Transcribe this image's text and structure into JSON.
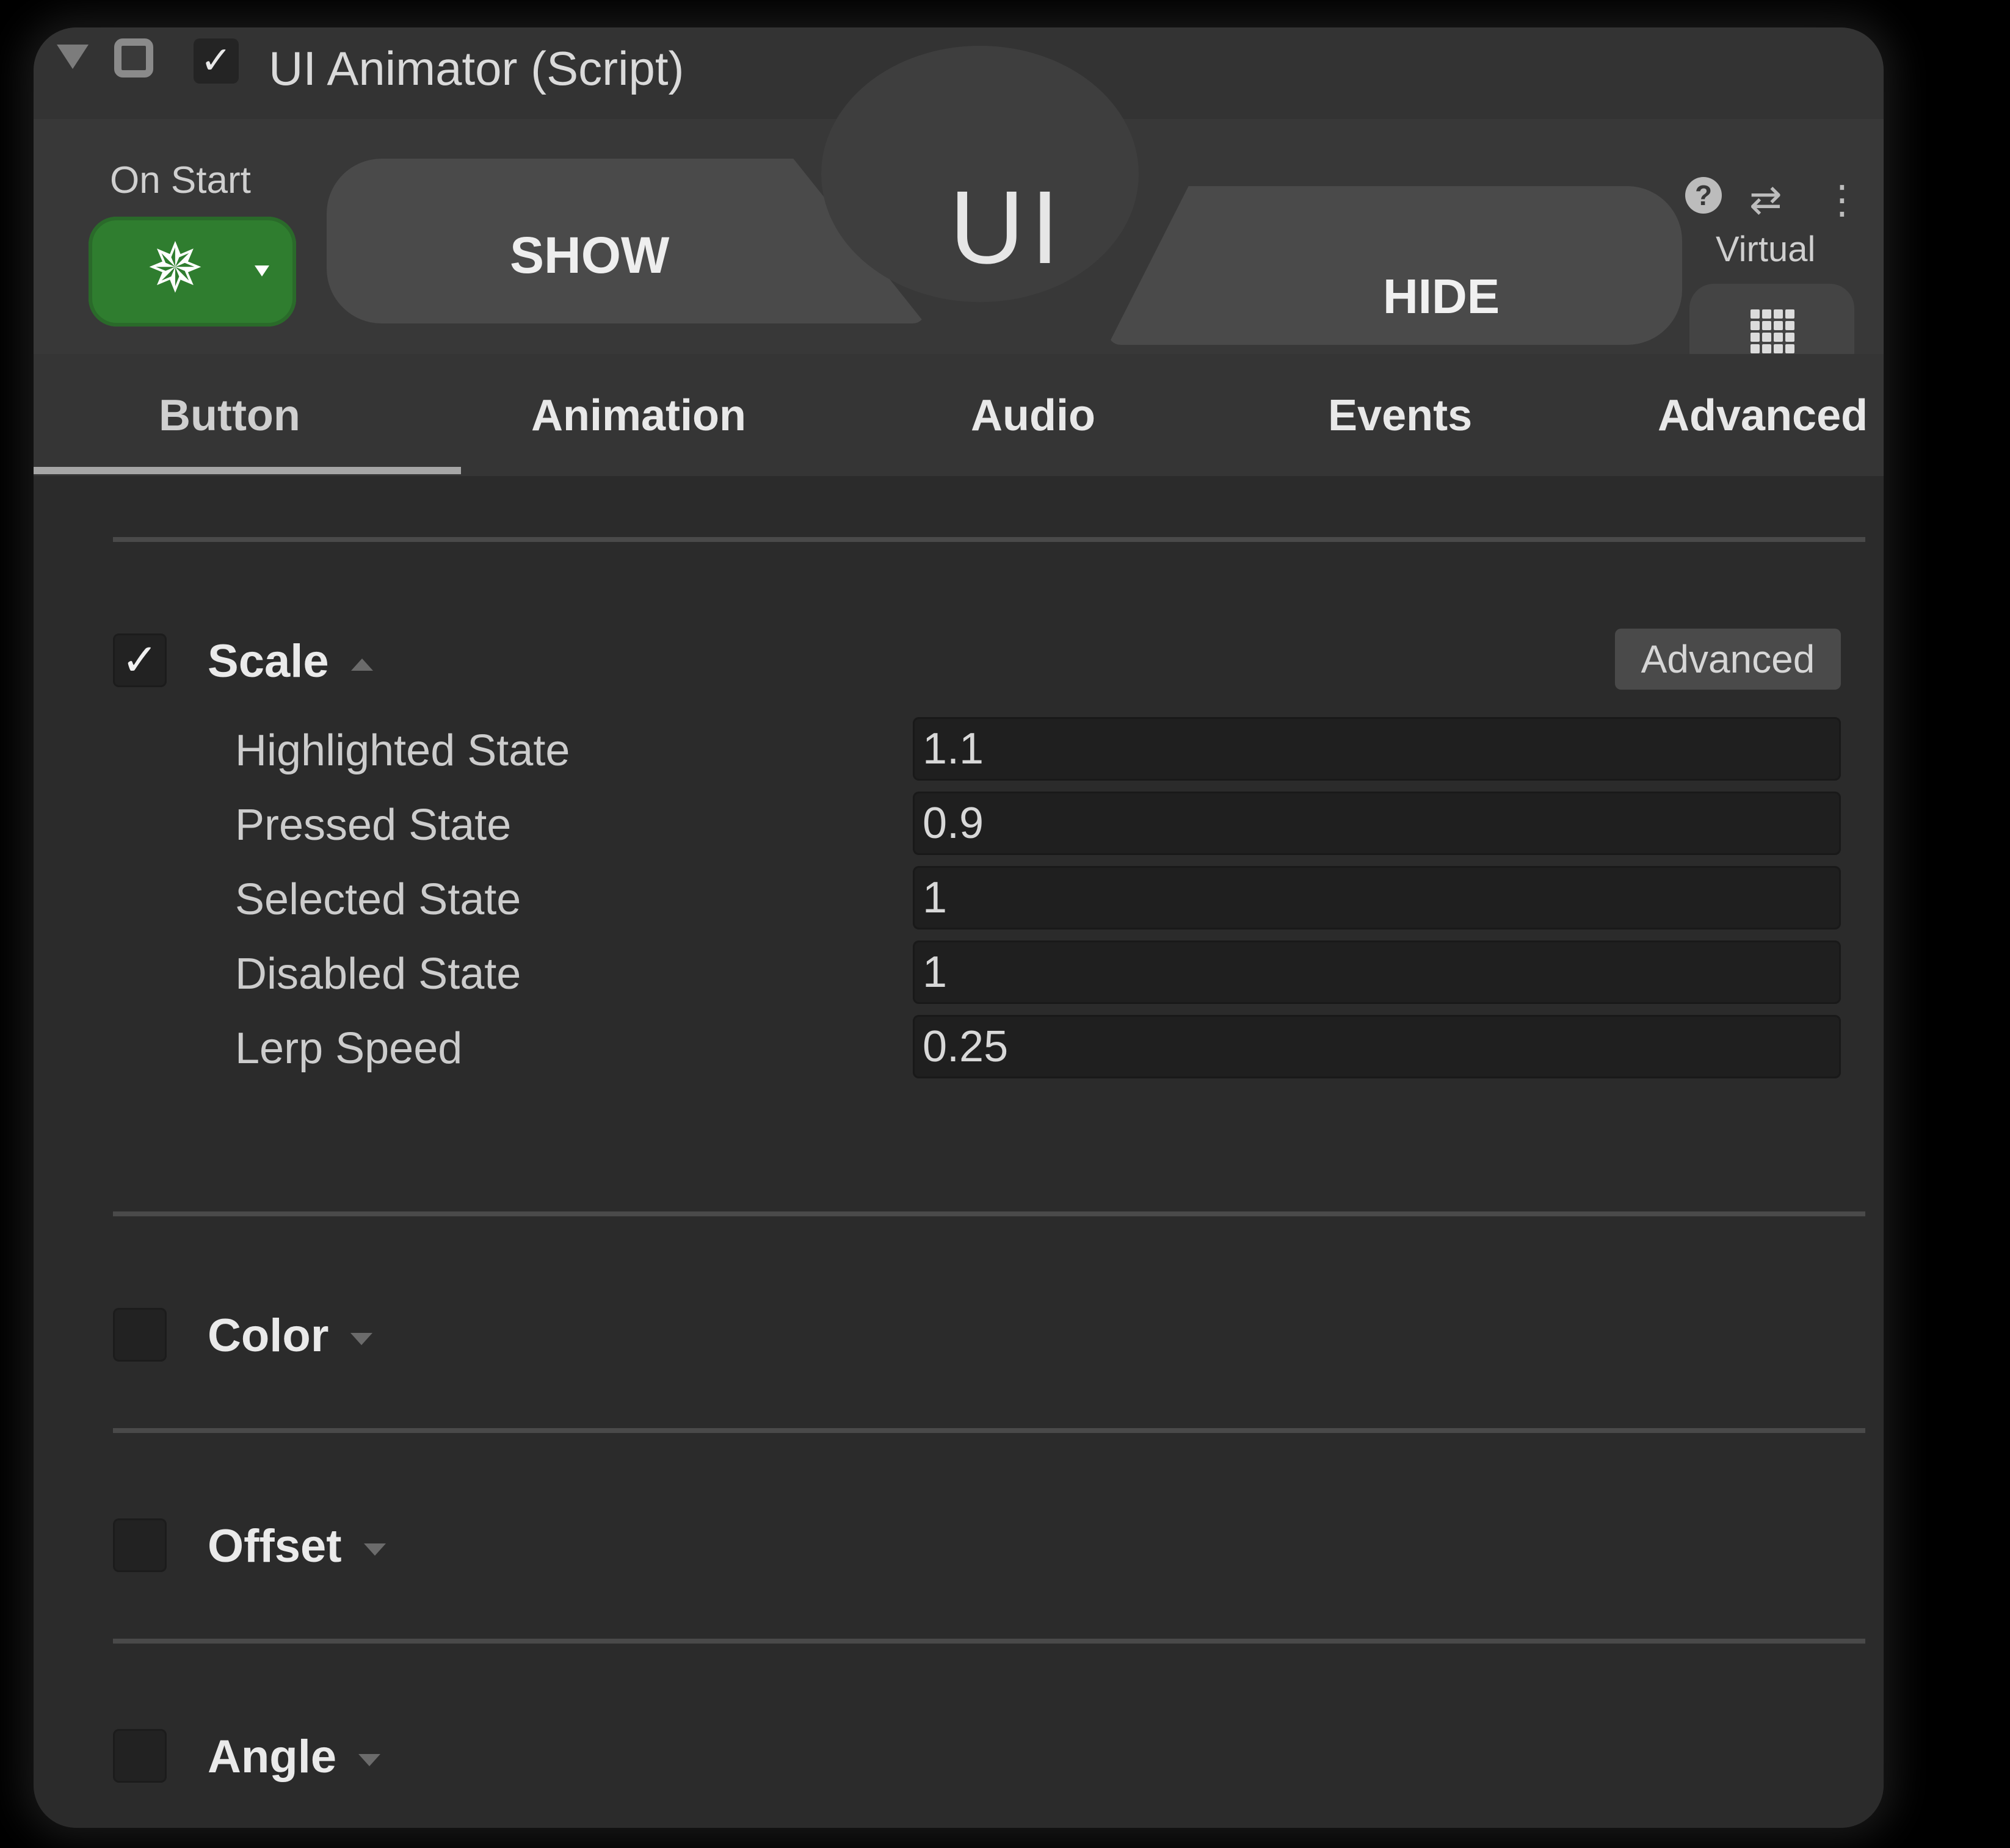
{
  "window": {
    "title": "UI Animator (Script)",
    "enabled_check": "✓"
  },
  "header": {
    "on_start_label": "On Start",
    "on_start_icon": "star-burst-icon",
    "show_label": "SHOW",
    "ui_label": "UI",
    "hide_label": "HIDE",
    "virtual_label": "Virtual",
    "virtual_icon": "grid-icon",
    "help_icon": "?",
    "presets_icon": "⇄",
    "more_icon": "⋮"
  },
  "tabs": [
    {
      "label": "Button",
      "active": true
    },
    {
      "label": "Animation",
      "active": false
    },
    {
      "label": "Audio",
      "active": false
    },
    {
      "label": "Events",
      "active": false
    },
    {
      "label": "Advanced",
      "active": false
    }
  ],
  "sections": {
    "scale": {
      "label": "Scale",
      "checked": true,
      "check_glyph": "✓",
      "expanded": true,
      "advanced_label": "Advanced",
      "fields": [
        {
          "label": "Highlighted State",
          "value": "1.1"
        },
        {
          "label": "Pressed State",
          "value": "0.9"
        },
        {
          "label": "Selected State",
          "value": "1"
        },
        {
          "label": "Disabled State",
          "value": "1"
        },
        {
          "label": "Lerp Speed",
          "value": "0.25"
        }
      ]
    },
    "color": {
      "label": "Color",
      "checked": false,
      "expanded": false
    },
    "offset": {
      "label": "Offset",
      "checked": false,
      "expanded": false
    },
    "angle": {
      "label": "Angle",
      "checked": false,
      "expanded": false
    }
  },
  "colors": {
    "panel_bg": "#2c2c2c",
    "on_start_green": "#2f7d2f",
    "field_bg": "#1f1f1f",
    "button_bg": "#4a4a4a"
  }
}
